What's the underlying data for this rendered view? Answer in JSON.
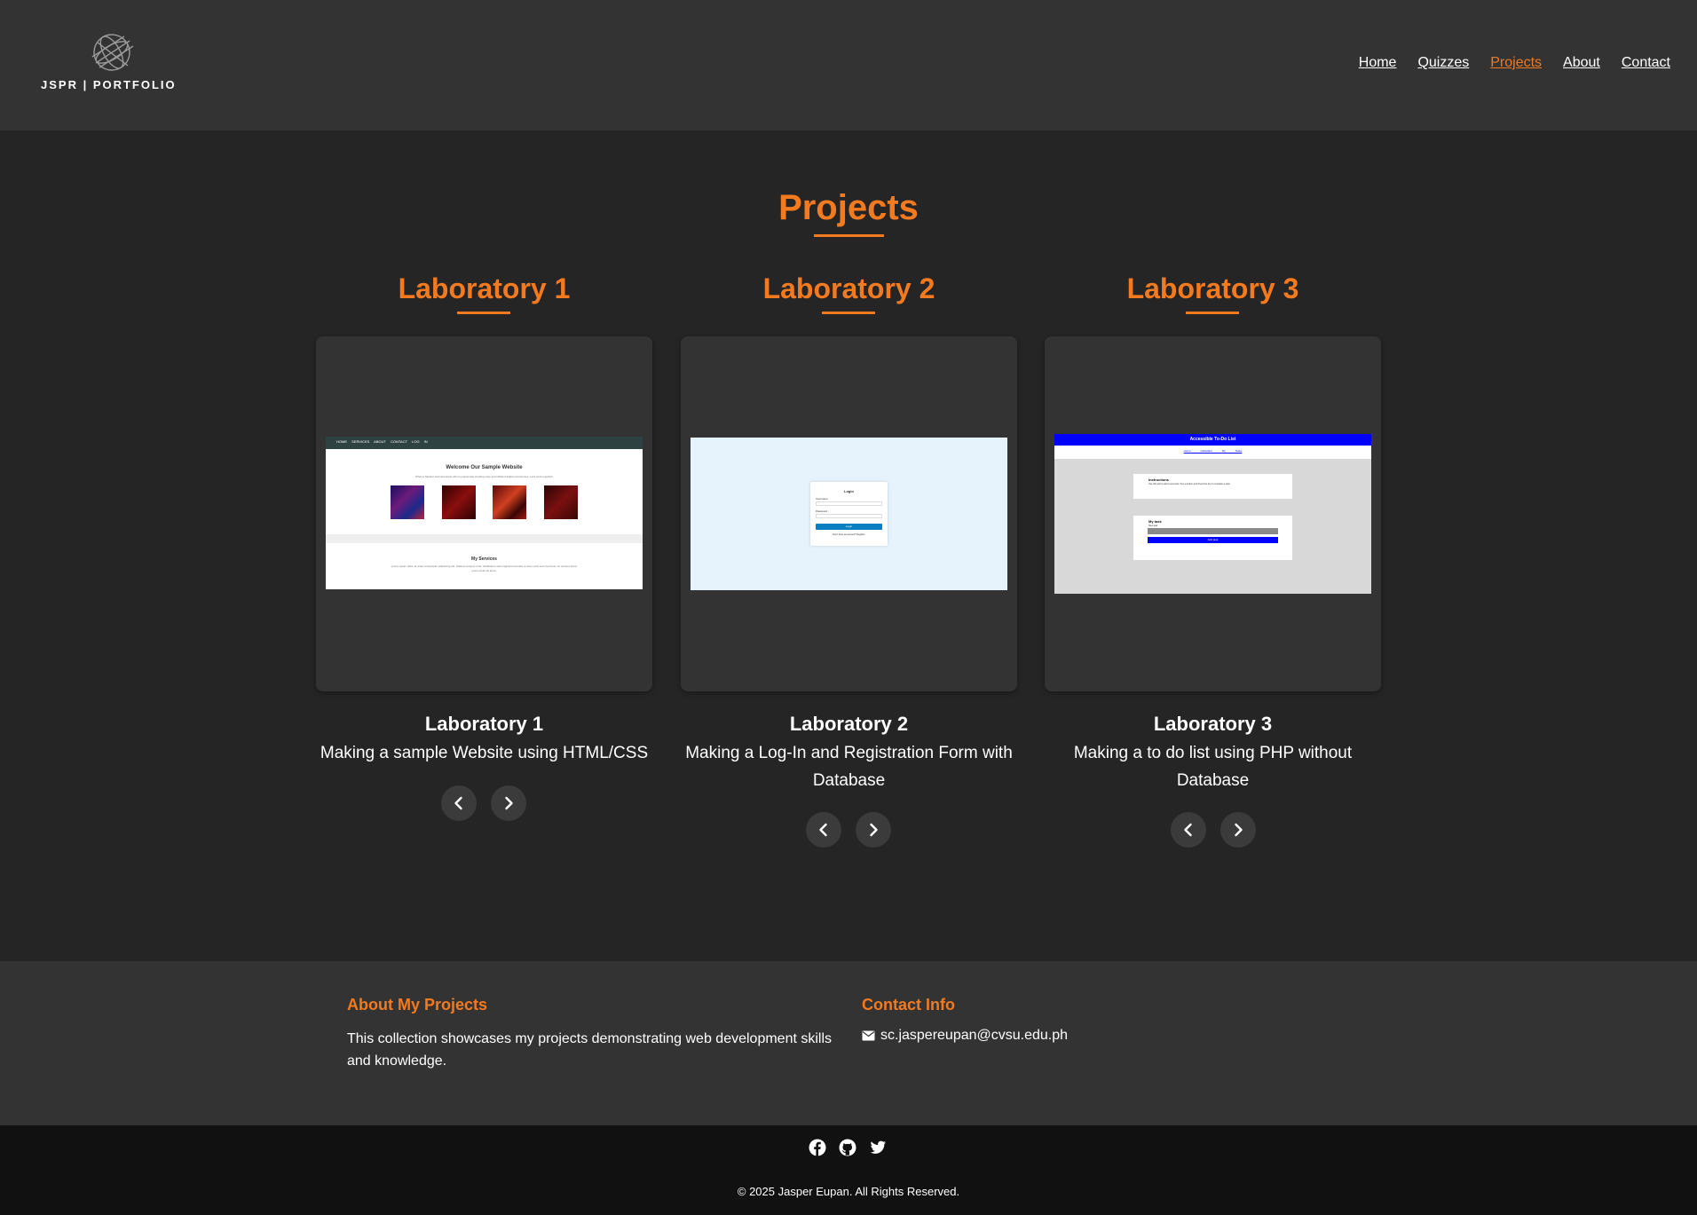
{
  "header": {
    "logo_text": "JSPR | PORTFOLIO",
    "nav": [
      {
        "label": "Home",
        "active": false
      },
      {
        "label": "Quizzes",
        "active": false
      },
      {
        "label": "Projects",
        "active": true
      },
      {
        "label": "About",
        "active": false
      },
      {
        "label": "Contact",
        "active": false
      }
    ]
  },
  "page": {
    "title": "Projects",
    "accent_color": "#f47a1f"
  },
  "labs": [
    {
      "title": "Laboratory 1",
      "name": "Laboratory 1",
      "description": "Making a sample Website using HTML/CSS",
      "screenshot": {
        "nav_items": [
          "HOME",
          "SERVICES",
          "ABOUT",
          "CONTACT",
          "LOG IN"
        ],
        "heading": "Welcome Our Sample Website",
        "subtitle": "What is Student web developer who is passionate creating easy and efficient digital experiences. Let's work together!",
        "services_title": "My Services",
        "services_text": "Lorem ipsum dolor sit amet consectetur adipiscing elit. Nulla ac tempus urna. Vestibulum velit magna fermentum a lorem quis sed viverra ac. Ut semper lorem ipsum dolor sit amet."
      }
    },
    {
      "title": "Laboratory 2",
      "name": "Laboratory 2",
      "description": "Making a Log-In and Registration Form with Database",
      "screenshot": {
        "heading": "Login",
        "label_user": "Username",
        "label_pass": "Password",
        "button": "Login",
        "link": "Don't have an account? Register"
      }
    },
    {
      "title": "Laboratory 3",
      "name": "Laboratory 3",
      "description": "Making a to do list using PHP without Database",
      "screenshot": {
        "heading": "Accessible To-Do List",
        "links": [
          "Home",
          "Calculator",
          "My Tasks"
        ],
        "instructions_title": "Instructions",
        "instructions_text": "Use this tool to add a new task, then a button and Press the key to complete a task.",
        "list_title": "My task",
        "list_label": "New task",
        "button": "Add task"
      }
    }
  ],
  "footer": {
    "about_heading": "About My Projects",
    "about_text": "This collection showcases my projects demonstrating web development skills and knowledge.",
    "contact_heading": "Contact Info",
    "email": "sc.jaspereupan@cvsu.edu.ph",
    "socials": [
      "facebook-icon",
      "github-icon",
      "twitter-icon"
    ],
    "copyright": "© 2025 Jasper Eupan. All Rights Reserved."
  }
}
